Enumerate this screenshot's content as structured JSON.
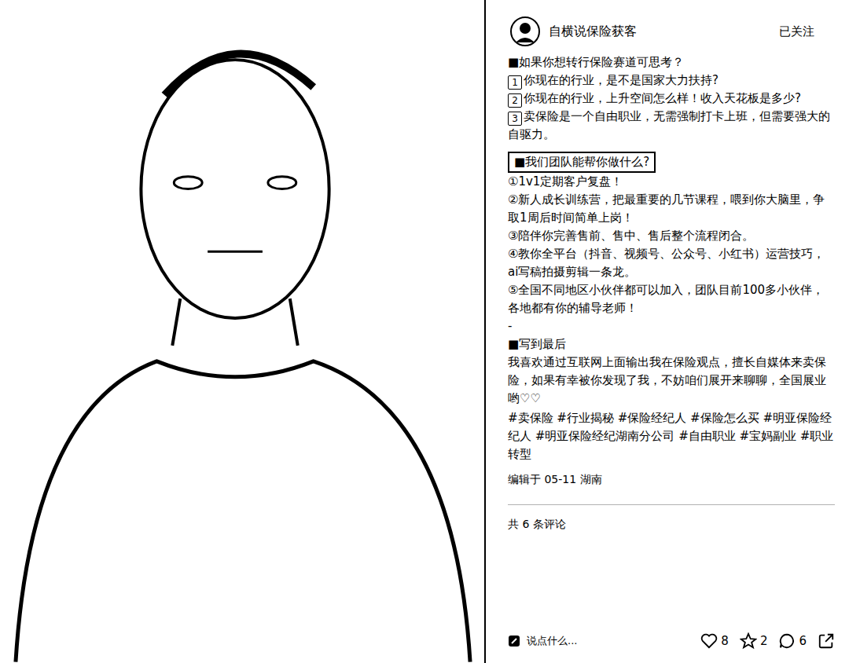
{
  "author": {
    "name": "自横说保险获客",
    "follow": "已关注"
  },
  "post": {
    "intro": "■如果你想转行保险赛道可思考？",
    "questions": [
      {
        "num": "1",
        "text": "你现在的行业，是不是国家大力扶持?"
      },
      {
        "num": "2",
        "text": "你现在的行业，上升空间怎么样！收入天花板是多少?"
      },
      {
        "num": "3",
        "text": "卖保险是一个自由职业，无需强制打卡上班，但需要强大的自驱力。"
      }
    ],
    "team_heading": "■我们团队能帮你做什么?",
    "team_items": [
      "①1v1定期客户复盘！",
      "②新人成长训练营，把最重要的几节课程，喂到你大脑里，争取1周后时间简单上岗！",
      "③陪伴你完善售前、售中、售后整个流程闭合。",
      "④教你全平台（抖音、视频号、公众号、小红书）运营技巧，ai写稿拍摄剪辑一条龙。",
      "⑤全国不同地区小伙伴都可以加入，团队目前100多小伙伴，各地都有你的辅导老师！"
    ],
    "divider": "-",
    "closing_heading": "■写到最后",
    "closing_text": "我喜欢通过互联网上面输出我在保险观点，擅长自媒体来卖保险，如果有幸被你发现了我，不妨咱们展开来聊聊，全国展业哟♡♡",
    "tags": [
      "#卖保险",
      "#行业揭秘",
      "#保险经纪人",
      "#保险怎么买",
      "#明亚保险经纪人",
      "#明亚保险经纪湖南分公司",
      "#自由职业",
      "#宝妈副业",
      "#职业转型"
    ],
    "meta": "编辑于 05-11 湖南",
    "comments_count": "共 6 条评论"
  },
  "action_bar": {
    "placeholder": "说点什么...",
    "likes": "8",
    "stars": "2",
    "comments": "6"
  }
}
